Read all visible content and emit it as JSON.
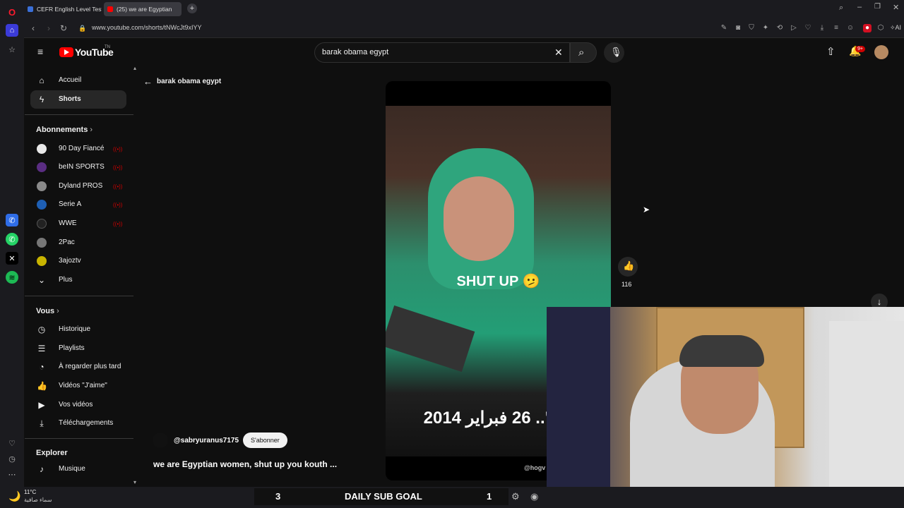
{
  "browser": {
    "tabs": [
      {
        "label": "CEFR English Level Test - I",
        "favicon_color": "#3a6fd8"
      },
      {
        "label": "(25) we are Egyptian",
        "favicon_color": "#ff0000"
      }
    ],
    "new_tab_label": "+",
    "url": "www.youtube.com/shorts/tNWcJt9xIYY",
    "ai_label": "AI",
    "notification_badge": "9+"
  },
  "youtube": {
    "logo_text": "YouTube",
    "region": "TN",
    "search_query": "barak obama egypt",
    "back_label": "barak obama egypt"
  },
  "sidebar": {
    "main": [
      {
        "label": "Accueil",
        "icon": "home-icon"
      },
      {
        "label": "Shorts",
        "icon": "shorts-icon"
      }
    ],
    "subscriptions_title": "Abonnements",
    "subscriptions": [
      {
        "label": "90 Day Fiancé",
        "color": "#e8e8e8",
        "live": true
      },
      {
        "label": "beIN SPORTS",
        "color": "#5a2d82",
        "live": true
      },
      {
        "label": "Dyland PROS",
        "color": "#8a8a8a",
        "live": true
      },
      {
        "label": "Serie A",
        "color": "#1e5fb4",
        "live": true
      },
      {
        "label": "WWE",
        "color": "#222222",
        "live": true
      },
      {
        "label": "2Pac",
        "color": "#777777",
        "live": false
      },
      {
        "label": "3ajoztv",
        "color": "#c8b400",
        "live": false
      }
    ],
    "more_label": "Plus",
    "you_title": "Vous",
    "you_items": [
      {
        "label": "Historique",
        "icon": "history-icon"
      },
      {
        "label": "Playlists",
        "icon": "playlist-icon"
      },
      {
        "label": "À regarder plus tard",
        "icon": "clock-icon"
      },
      {
        "label": "Vidéos \"J'aime\"",
        "icon": "thumbs-up-icon"
      },
      {
        "label": "Vos vidéos",
        "icon": "video-icon"
      },
      {
        "label": "Téléchargements",
        "icon": "download-icon"
      }
    ],
    "explore_title": "Explorer",
    "explore_items": [
      {
        "label": "Musique",
        "icon": "music-icon"
      }
    ]
  },
  "short": {
    "channel": "@sabryuranus7175",
    "subscribe_label": "S'abonner",
    "title": "we are Egyptian women, shut up you kouth ...",
    "caption": "SHUT UP 🫤",
    "arabic_caption": "مج\".. 26 فبراير 2014",
    "watermark": "@hogv",
    "like_count": "116"
  },
  "stream_overlay": {
    "goal_left": "3",
    "goal_label": "DAILY SUB GOAL",
    "goal_right": "1"
  },
  "taskbar": {
    "temperature": "11°C",
    "weather_text": "سماء صافية"
  }
}
